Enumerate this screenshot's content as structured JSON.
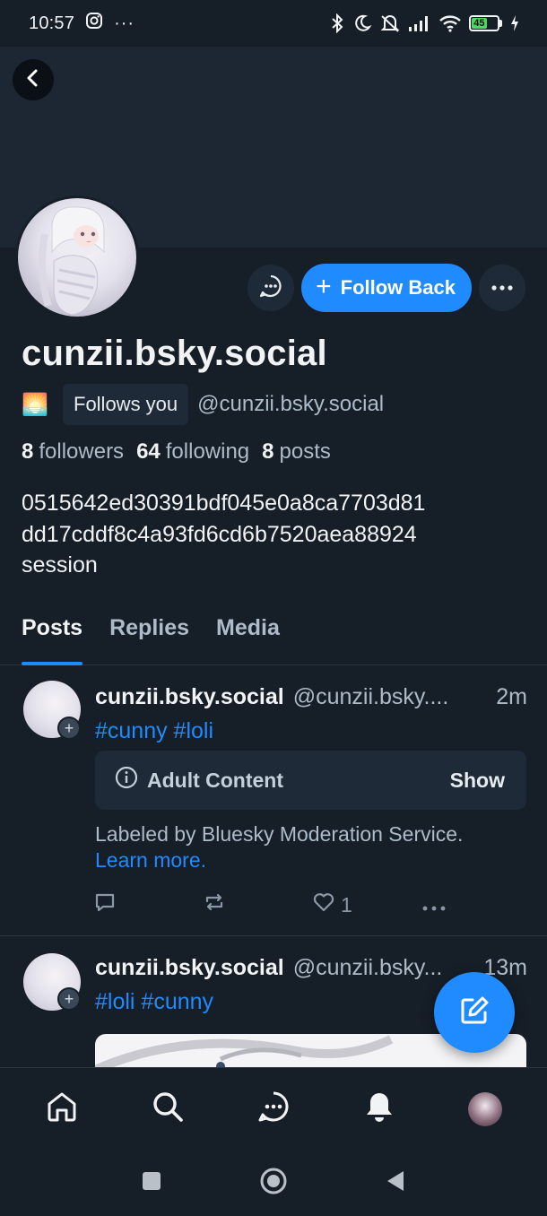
{
  "status_bar": {
    "time": "10:57",
    "battery": "45"
  },
  "profile": {
    "display_name": "cunzii.bsky.social",
    "emoji": "🌅",
    "follows_you": "Follows you",
    "handle": "@cunzii.bsky.social",
    "followers_count": "8",
    "followers_label": "followers",
    "following_count": "64",
    "following_label": "following",
    "posts_count": "8",
    "posts_label": "posts",
    "bio_line1": "0515642ed30391bdf045e0a8ca7703d81",
    "bio_line2": "dd17cddf8c4a93fd6cd6b7520aea88924",
    "bio_line3": "session",
    "follow_back_label": "Follow Back"
  },
  "tabs": [
    "Posts",
    "Replies",
    "Media"
  ],
  "posts": [
    {
      "name": "cunzii.bsky.social",
      "handle": "@cunzii.bsky....",
      "time": "2m",
      "tags": "#cunny #loli",
      "adult_label": "Adult Content",
      "show_label": "Show",
      "mod_note": "Labeled by Bluesky Moderation Service.",
      "learn_more": "Learn more.",
      "likes": "1"
    },
    {
      "name": "cunzii.bsky.social",
      "handle": "@cunzii.bsky...",
      "time": "13m",
      "tags": "#loli #cunny"
    }
  ],
  "colors": {
    "accent": "#208bfe",
    "background": "#161e27",
    "surface": "#1e2a37"
  }
}
